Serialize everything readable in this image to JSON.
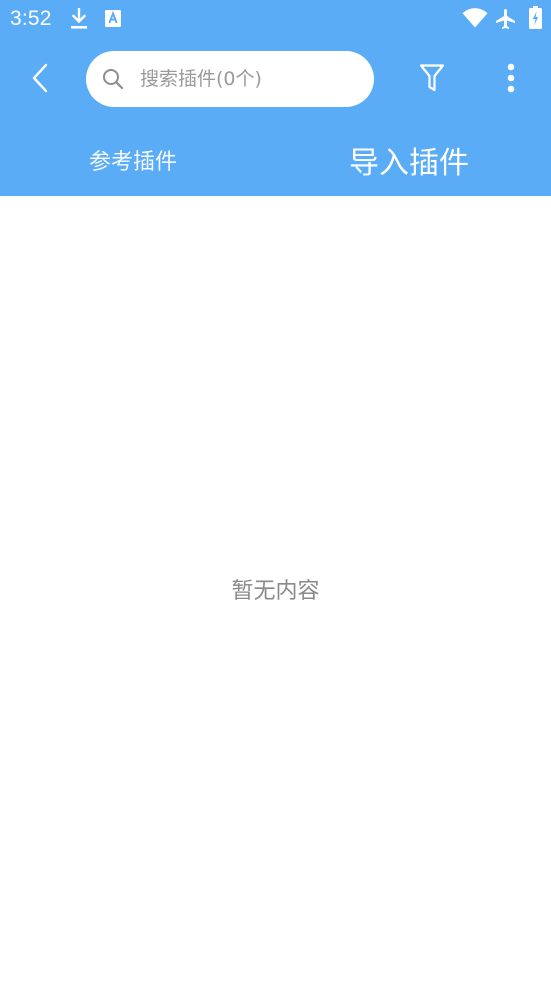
{
  "status_bar": {
    "time": "3:52",
    "icons": [
      "download-icon",
      "font-a-icon",
      "wifi-icon",
      "airplane-mode-icon",
      "battery-charging-icon"
    ]
  },
  "toolbar": {
    "back_icon": "chevron-left-icon",
    "search": {
      "placeholder": "搜索插件(0个)",
      "value": "",
      "icon": "search-icon"
    },
    "filter_icon": "filter-icon",
    "more_icon": "more-vertical-icon"
  },
  "tabs": [
    {
      "label": "参考插件",
      "selected": false
    },
    {
      "label": "导入插件",
      "selected": true
    }
  ],
  "content": {
    "empty_text": "暂无内容"
  },
  "colors": {
    "header_bg": "#5aacf6",
    "page_bg": "#ffffff",
    "empty_text": "#8a8a8a"
  }
}
